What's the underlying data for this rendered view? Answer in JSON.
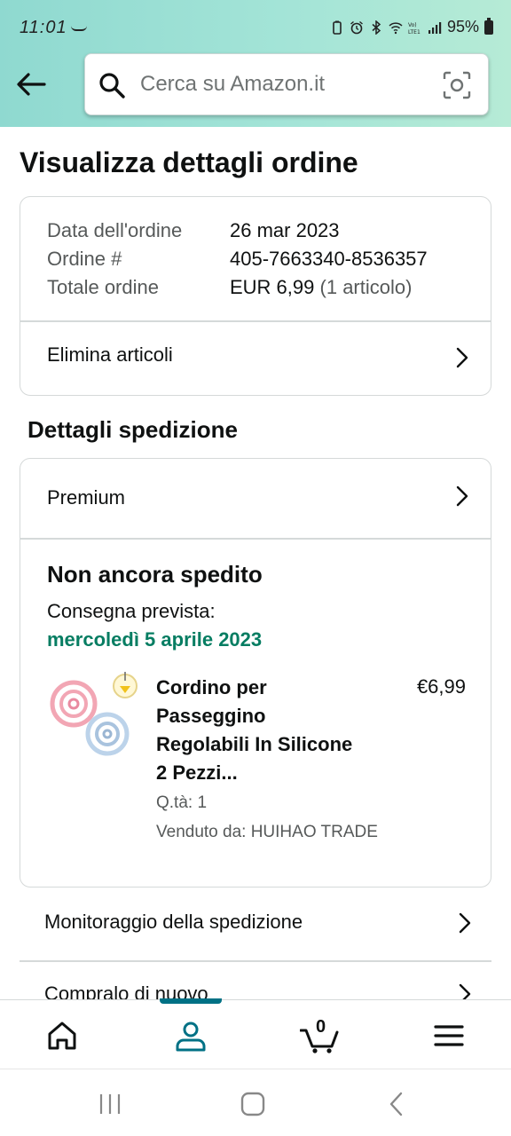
{
  "status_bar": {
    "time": "11:01",
    "battery": "95%"
  },
  "search": {
    "placeholder": "Cerca su Amazon.it"
  },
  "page": {
    "title": "Visualizza dettagli ordine"
  },
  "order": {
    "date_label": "Data dell'ordine",
    "date_value": "26 mar 2023",
    "number_label": "Ordine #",
    "number_value": "405-7663340-8536357",
    "total_label": "Totale ordine",
    "total_value": "EUR 6,99",
    "total_items": "(1 articolo)",
    "delete_label": "Elimina articoli"
  },
  "shipping": {
    "section_title": "Dettagli spedizione",
    "shipping_method": "Premium",
    "status": "Non ancora spedito",
    "delivery_label": "Consegna prevista:",
    "delivery_date": "mercoledì 5 aprile 2023",
    "product": {
      "name": "Cordino per Passeggino Regolabili In Silicone 2 Pezzi...",
      "price": "€6,99",
      "quantity": "Q.tà: 1",
      "seller": "Venduto da: HUIHAO TRADE"
    }
  },
  "actions": {
    "track": "Monitoraggio della spedizione",
    "buy_again": "Compralo di nuovo"
  },
  "bottom_nav": {
    "cart_count": "0",
    "active_tab": "account"
  },
  "colors": {
    "header_start": "#8fd9d0",
    "header_end": "#b6ebd6",
    "delivery_green": "#067d62",
    "active_teal": "#007185"
  }
}
